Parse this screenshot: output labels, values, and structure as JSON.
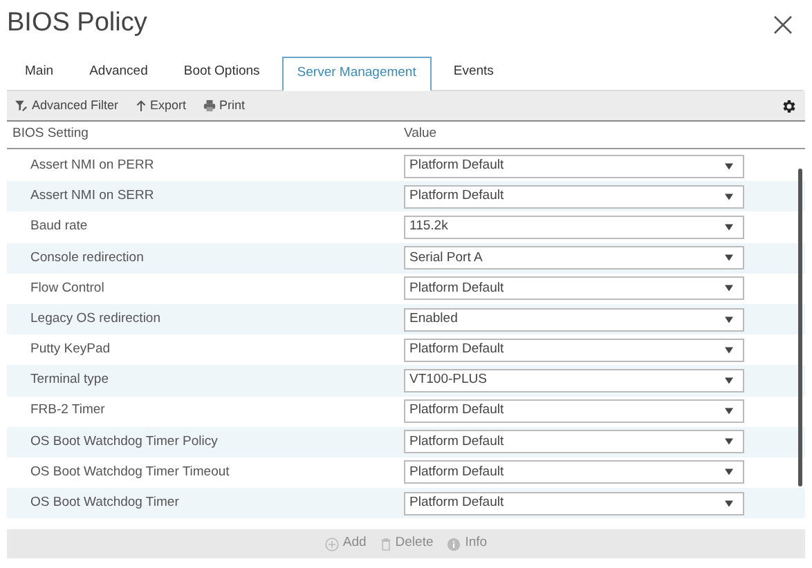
{
  "window": {
    "title": "BIOS Policy"
  },
  "tabs": [
    {
      "label": "Main",
      "selected": false
    },
    {
      "label": "Advanced",
      "selected": false
    },
    {
      "label": "Boot Options",
      "selected": false
    },
    {
      "label": "Server Management",
      "selected": true
    },
    {
      "label": "Events",
      "selected": false
    }
  ],
  "toolbar": [
    {
      "kind": "filter",
      "label": "Advanced Filter"
    },
    {
      "kind": "export",
      "label": "Export"
    },
    {
      "kind": "print",
      "label": "Print"
    }
  ],
  "table": {
    "columns": [
      "BIOS Setting",
      "Value"
    ],
    "rows": [
      {
        "setting": "Assert NMI on PERR",
        "value": "Platform Default"
      },
      {
        "setting": "Assert NMI on SERR",
        "value": "Platform Default"
      },
      {
        "setting": "Baud rate",
        "value": "115.2k"
      },
      {
        "setting": "Console redirection",
        "value": "Serial Port A"
      },
      {
        "setting": "Flow Control",
        "value": "Platform Default"
      },
      {
        "setting": "Legacy OS redirection",
        "value": "Enabled"
      },
      {
        "setting": "Putty KeyPad",
        "value": "Platform Default"
      },
      {
        "setting": "Terminal type",
        "value": "VT100-PLUS"
      },
      {
        "setting": "FRB-2 Timer",
        "value": "Platform Default"
      },
      {
        "setting": "OS Boot Watchdog Timer Policy",
        "value": "Platform Default"
      },
      {
        "setting": "OS Boot Watchdog Timer Timeout",
        "value": "Platform Default"
      },
      {
        "setting": "OS Boot Watchdog Timer",
        "value": "Platform Default"
      }
    ]
  },
  "footer_actions": [
    {
      "kind": "add",
      "label": "Add",
      "disabled": true
    },
    {
      "kind": "delete",
      "label": "Delete",
      "disabled": true
    },
    {
      "kind": "info",
      "label": "Info",
      "disabled": true
    }
  ]
}
